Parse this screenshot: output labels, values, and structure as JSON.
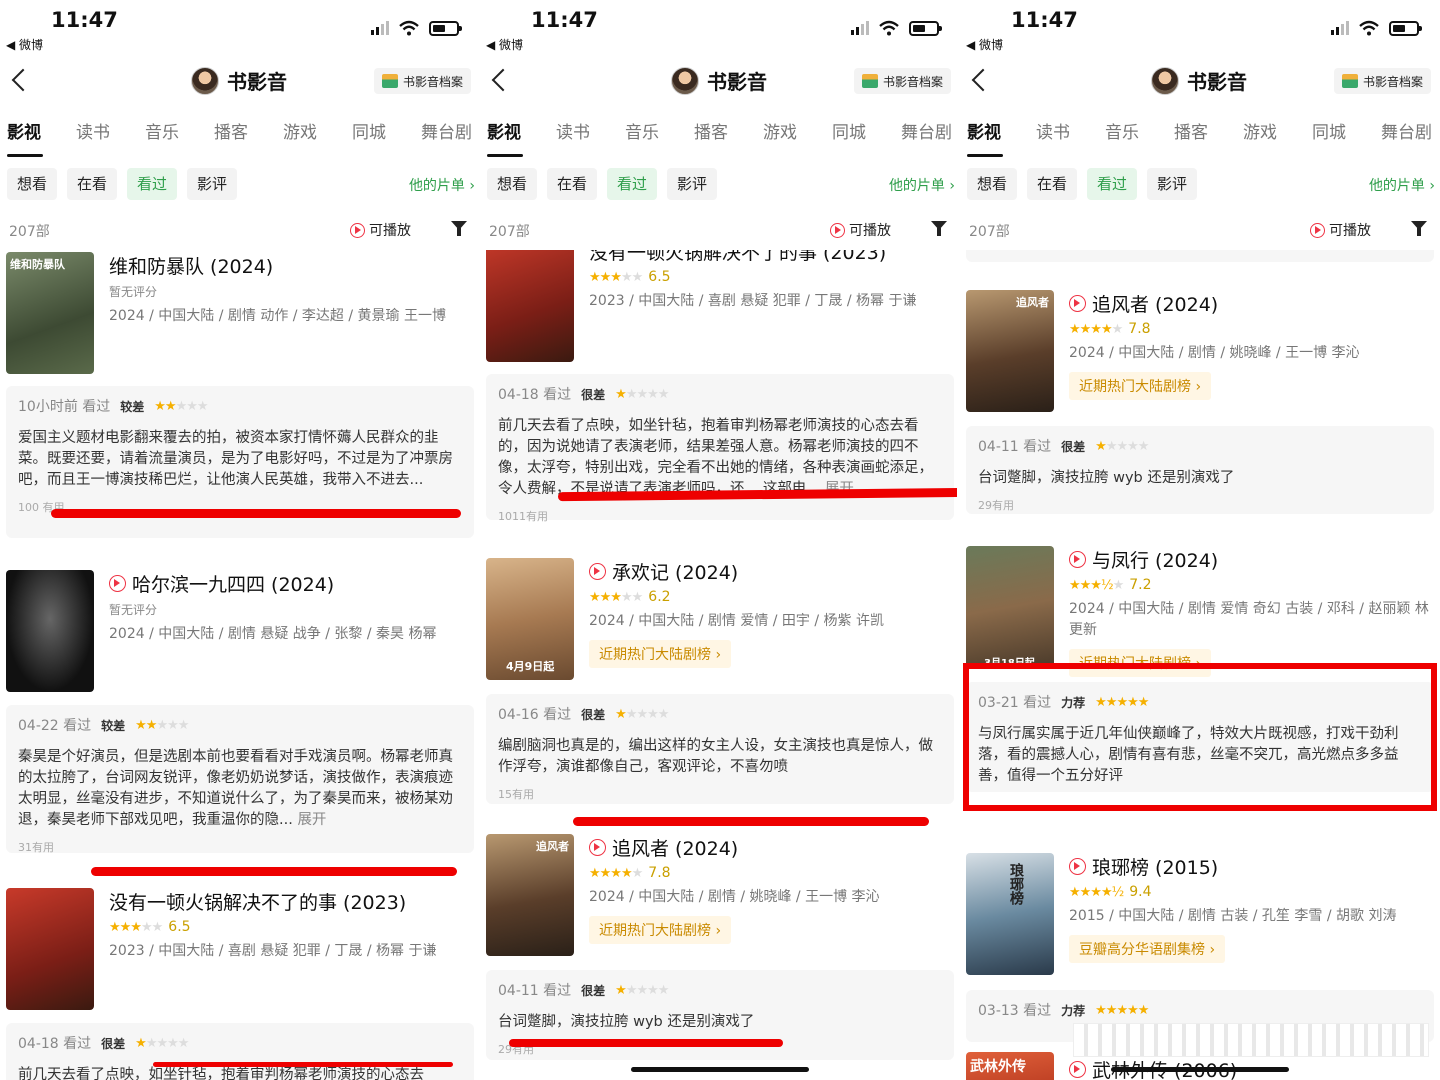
{
  "status": {
    "time": "11:47",
    "back_app": "◀ 微博"
  },
  "nav": {
    "title": "书影音",
    "archive_label": "书影音档案"
  },
  "tabs": [
    "影视",
    "读书",
    "音乐",
    "播客",
    "游戏",
    "同城",
    "舞台剧"
  ],
  "subtabs": [
    "想看",
    "在看",
    "看过",
    "影评"
  ],
  "active_subtab": "看过",
  "my_list": "他的片单 ›",
  "count": "207部",
  "playable": "可播放",
  "colors": {
    "accent_green": "#2e9e4a",
    "annotation_red": "#ee0000",
    "star": "#f5b000"
  },
  "panels": [
    {
      "items": [
        {
          "title": "维和防暴队 (2024)",
          "no_rating": "暂无评分",
          "meta": "2024 / 中国大陆 / 剧情 动作 / 李达超 / 黄景瑜 王一博",
          "poster_text": "维和防暴队"
        },
        {
          "title": "哈尔滨一九四四 (2024)",
          "no_rating": "暂无评分",
          "meta": "2024 / 中国大陆 / 剧情 悬疑 战争 / 张黎 / 秦昊 杨幂"
        },
        {
          "title": "没有一顿火锅解决不了的事 (2023)",
          "score": "6.5",
          "meta": "2023 / 中国大陆 / 喜剧 悬疑 犯罪 / 丁晟 / 杨幂 于谦"
        }
      ],
      "reviews": [
        {
          "date": "10小时前 看过",
          "grade": "较差",
          "body": "爱国主义题材电影翻来覆去的拍，被资本家打情怀薅人民群众的韭菜。既要还要，请着流量演员，是为了电影好吗，不过是为了冲票房吧，而且王一博演技稀巴烂，让他演人民英雄，我带入不进去...",
          "useful": "100 有用"
        },
        {
          "date": "04-22 看过",
          "grade": "较差",
          "body": "秦昊是个好演员，但是选剧本前也要看看对手戏演员啊。杨幂老师真的太拉胯了，台词网友锐评，像老奶奶说梦话，演技做作，表演痕迹太明显，丝毫没有进步，不知道说什么了，为了秦昊而来，被杨某劝退，秦昊老师下部戏见吧，我重温你的隐...",
          "more": "展开",
          "useful": "31有用"
        },
        {
          "date": "04-18 看过",
          "grade": "很差",
          "body": "前几天去看了点映，如坐针毡，抱着审判杨幂老师演技的心态去"
        }
      ]
    },
    {
      "items": [
        {
          "title": "没有一顿火锅解决不了的事 (2023)",
          "score": "6.5",
          "meta": "2023 / 中国大陆 / 喜剧 悬疑 犯罪 / 丁晟 / 杨幂 于谦"
        },
        {
          "title": "承欢记 (2024)",
          "score": "6.2",
          "meta": "2024 / 中国大陆 / 剧情 爱情 / 田宇 / 杨紫 许凯",
          "ranking": "近期热门大陆剧榜 ›",
          "poster_text": "4月9日起"
        },
        {
          "title": "追风者 (2024)",
          "score": "7.8",
          "meta": "2024 / 中国大陆 / 剧情 / 姚晓峰 / 王一博 李沁",
          "ranking": "近期热门大陆剧榜 ›",
          "poster_text": "追风者"
        }
      ],
      "reviews": [
        {
          "date": "04-18 看过",
          "grade": "很差",
          "body": "前几天去看了点映，如坐针毡，抱着审判杨幂老师演技的心态去看的，因为说她请了表演老师，结果差强人意。杨幂老师演技的四不像，太浮夸，特别出戏，完全看不出她的情绪，各种表演画蛇添足，令人费解，不是说请了表演老师吗，还... 这部电...",
          "more": "展开",
          "useful": "1011有用"
        },
        {
          "date": "04-16 看过",
          "grade": "很差",
          "body": "编剧脑洞也真是的，编出这样的女主人设，女主演技也真是惊人，做作浮夸，演谁都像自己，客观评论，不喜勿喷",
          "useful": "15有用"
        },
        {
          "date": "04-11 看过",
          "grade": "很差",
          "body": "台词蹩脚，演技拉胯 wyb 还是别演戏了",
          "useful": "29有用"
        }
      ]
    },
    {
      "items": [
        {
          "title": "追风者 (2024)",
          "score": "7.8",
          "meta": "2024 / 中国大陆 / 剧情 / 姚晓峰 / 王一博 李沁",
          "ranking": "近期热门大陆剧榜 ›",
          "poster_text": "追风者"
        },
        {
          "title": "与凤行 (2024)",
          "score": "7.2",
          "meta": "2024 / 中国大陆 / 剧情 爱情 奇幻 古装 / 邓科 / 赵丽颖 林更新",
          "ranking": "近期热门大陆剧榜 ›",
          "poster_text": "3月18日起"
        },
        {
          "title": "琅琊榜 (2015)",
          "score": "9.4",
          "meta": "2015 / 中国大陆 / 剧情 古装 / 孔笙 李雪 / 胡歌 刘涛",
          "ranking": "豆瓣高分华语剧集榜 ›",
          "poster_text": "琅琊榜"
        },
        {
          "title": "武林外传 (2006)",
          "poster_text": "武林外传"
        }
      ],
      "reviews": [
        {
          "date": "04-11 看过",
          "grade": "很差",
          "body": "台词蹩脚，演技拉胯 wyb 还是别演戏了",
          "useful": "29有用"
        },
        {
          "date": "03-21 看过",
          "grade": "力荐",
          "body": "与凤行属实属于近几年仙侠巅峰了，特效大片既视感，打戏干劲利落，看的震撼人心，剧情有喜有悲，丝毫不突兀，高光燃点多多益善，值得一个五分好评"
        },
        {
          "date": "03-13 看过",
          "grade": "力荐"
        }
      ]
    }
  ]
}
